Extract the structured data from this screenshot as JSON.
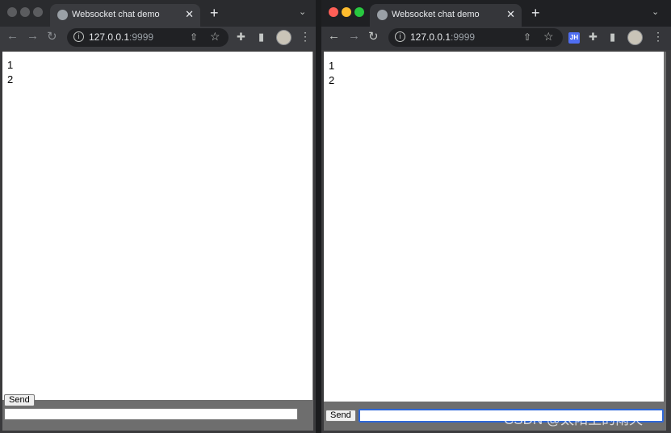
{
  "windows": [
    {
      "tab": {
        "title": "Websocket chat demo",
        "close": "✕"
      },
      "new_tab": "+",
      "tab_menu": "⌄",
      "nav": {
        "back": "←",
        "forward": "→",
        "reload": "↻"
      },
      "address": {
        "host": "127.0.0.1",
        "port": ":9999",
        "info": "i"
      },
      "icons": {
        "share": "⇧",
        "star": "☆",
        "extensions": "✚",
        "side_panel": "▮",
        "menu": "⋮"
      },
      "messages": [
        "1",
        "2"
      ],
      "send_label": "Send",
      "input_value": ""
    },
    {
      "tab": {
        "title": "Websocket chat demo",
        "close": "✕"
      },
      "new_tab": "+",
      "tab_menu": "⌄",
      "nav": {
        "back": "←",
        "forward": "→",
        "reload": "↻"
      },
      "address": {
        "host": "127.0.0.1",
        "port": ":9999",
        "info": "i"
      },
      "icons": {
        "share": "⇧",
        "star": "☆",
        "extension_jh": "JH",
        "extensions": "✚",
        "side_panel": "▮",
        "menu": "⋮"
      },
      "messages": [
        "1",
        "2"
      ],
      "send_label": "Send",
      "input_value": ""
    }
  ],
  "watermark": "CSDN @太阳上的雨天",
  "colors": {
    "focus_ring": "#2f68d8",
    "close": "#ff5f57",
    "minimize": "#febc2e",
    "zoom": "#28c840"
  }
}
